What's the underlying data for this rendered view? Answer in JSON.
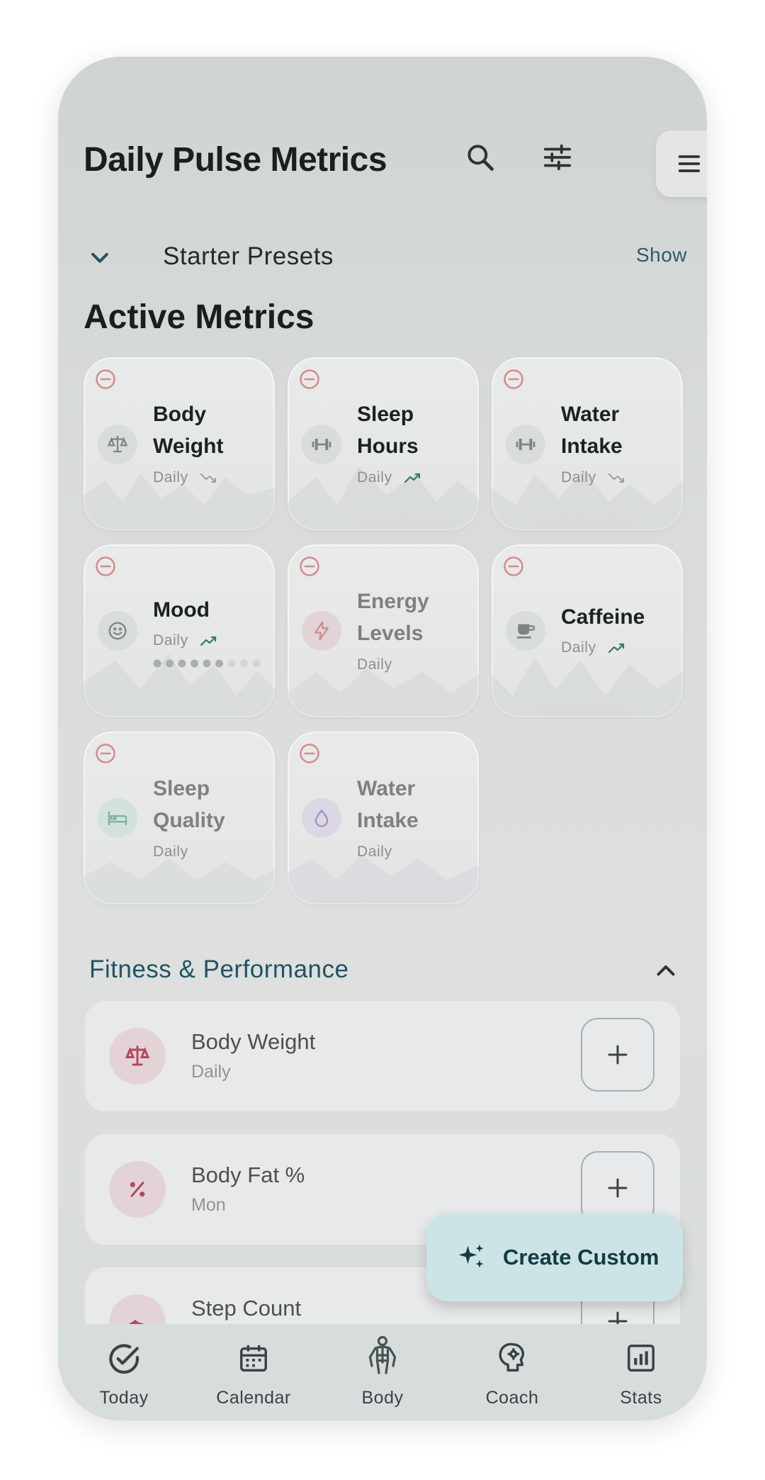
{
  "header": {
    "title": "Daily Pulse Metrics"
  },
  "presets": {
    "label": "Starter Presets",
    "show_label": "Show"
  },
  "active_section": {
    "title": "Active Metrics"
  },
  "active_cards": [
    {
      "name_line1": "Body",
      "name_line2": "Weight",
      "frequency": "Daily",
      "icon": "scale-icon",
      "trend": "trending-down-icon"
    },
    {
      "name_line1": "Sleep",
      "name_line2": "Hours",
      "frequency": "Daily",
      "icon": "dumbbell-icon",
      "trend": "trending-up-icon"
    },
    {
      "name_line1": "Water",
      "name_line2": "Intake",
      "frequency": "Daily",
      "icon": "dumbbell-icon",
      "trend": "trending-down-icon"
    },
    {
      "name_line1": "Mood",
      "name_line2": "",
      "frequency": "Daily",
      "icon": "smile-icon",
      "trend": "trending-up-icon",
      "rating_filled": 6,
      "rating_total": 9
    },
    {
      "name_line1": "Energy",
      "name_line2": "Levels",
      "frequency": "Daily",
      "icon": "bolt-icon"
    },
    {
      "name_line1": "Caffeine",
      "name_line2": "",
      "frequency": "Daily",
      "icon": "coffee-icon",
      "trend": "trending-up-icon"
    },
    {
      "name_line1": "Sleep",
      "name_line2": "Quality",
      "frequency": "Daily",
      "icon": "bed-icon"
    },
    {
      "name_line1": "Water",
      "name_line2": "Intake",
      "frequency": "Daily",
      "icon": "drop-icon"
    }
  ],
  "fitness": {
    "title": "Fitness & Performance",
    "items": [
      {
        "name": "Body Weight",
        "frequency": "Daily",
        "icon": "scale-icon"
      },
      {
        "name": "Body Fat %",
        "frequency": "Mon",
        "icon": "percent-icon"
      },
      {
        "name": "Step Count",
        "frequency": "",
        "icon": "shoe-icon"
      }
    ]
  },
  "fab": {
    "label": "Create Custom",
    "icon": "sparkle-icon"
  },
  "nav": [
    {
      "label": "Today",
      "icon": "check-circle-icon"
    },
    {
      "label": "Calendar",
      "icon": "calendar-icon"
    },
    {
      "label": "Body",
      "icon": "body-icon"
    },
    {
      "label": "Coach",
      "icon": "brain-icon"
    },
    {
      "label": "Stats",
      "icon": "chart-icon"
    }
  ],
  "colors": {
    "accent_teal": "#1e5563",
    "remove_red": "#d98a8a",
    "trend_green": "#2f7a66",
    "fab_bg": "#cce4e6"
  }
}
